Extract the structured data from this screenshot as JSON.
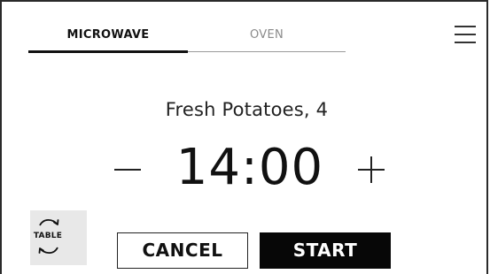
{
  "tabs": [
    {
      "label": "MICROWAVE",
      "active": true
    },
    {
      "label": "OVEN",
      "active": false
    }
  ],
  "menu": {
    "icon": "hamburger-menu-icon"
  },
  "program": {
    "title": "Fresh Potatoes, 4",
    "time": "14:00"
  },
  "controls": {
    "decrease_icon": "minus-icon",
    "increase_icon": "plus-icon"
  },
  "table_button": {
    "label": "TABLE",
    "icon": "rotate-arrows-icon"
  },
  "actions": {
    "cancel_label": "CANCEL",
    "start_label": "START"
  },
  "colors": {
    "active_tab": "#111111",
    "inactive_tab": "#8a8a8a",
    "start_background": "#070707",
    "table_background": "#e8e8e8"
  }
}
